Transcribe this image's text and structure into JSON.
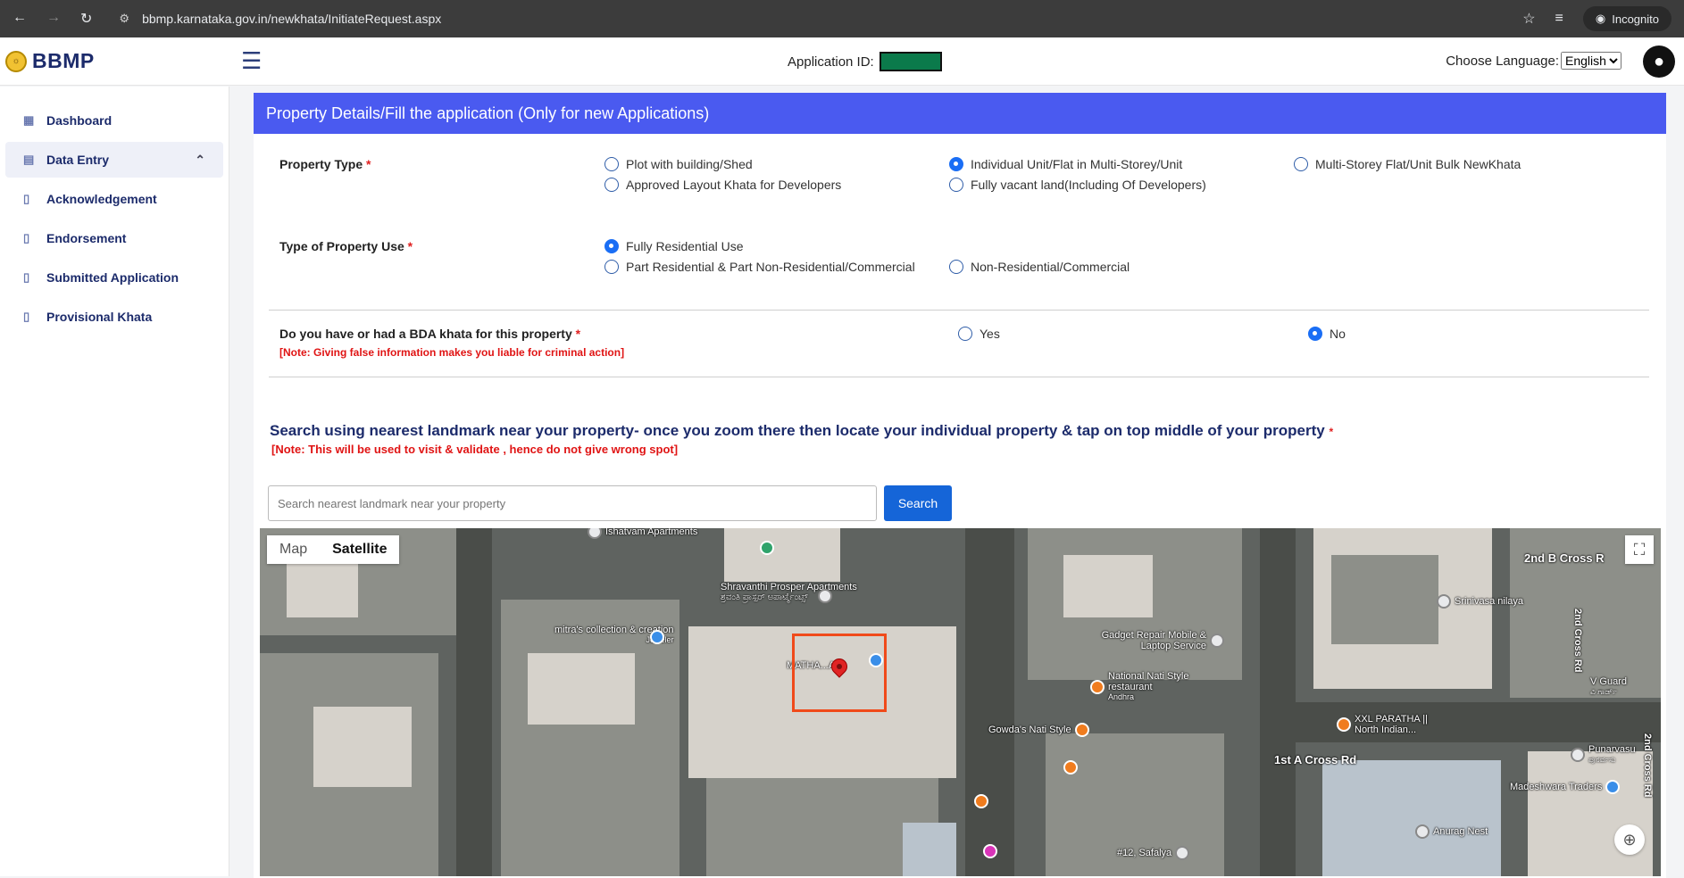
{
  "browser": {
    "url": "bbmp.karnataka.gov.in/newkhata/InitiateRequest.aspx",
    "incognito_label": "Incognito"
  },
  "header": {
    "brand": "BBMP",
    "application_id_label": "Application ID:",
    "language_label": "Choose Language:",
    "language_selected": "English"
  },
  "sidebar": {
    "items": [
      {
        "label": "Dashboard"
      },
      {
        "label": "Data Entry"
      },
      {
        "label": "Acknowledgement"
      },
      {
        "label": "Endorsement"
      },
      {
        "label": "Submitted Application"
      },
      {
        "label": "Provisional Khata"
      }
    ]
  },
  "form": {
    "title": "Property Details/Fill the application (Only for new Applications)",
    "property_type": {
      "label": "Property Type",
      "options": [
        {
          "label": "Plot with building/Shed",
          "selected": false
        },
        {
          "label": "Individual Unit/Flat in Multi-Storey/Unit",
          "selected": true
        },
        {
          "label": "Multi-Storey Flat/Unit Bulk NewKhata",
          "selected": false
        },
        {
          "label": "Approved Layout Khata for Developers",
          "selected": false
        },
        {
          "label": "Fully vacant land(Including Of Developers)",
          "selected": false
        }
      ]
    },
    "property_use": {
      "label": "Type of Property Use",
      "options": [
        {
          "label": "Fully Residential Use",
          "selected": true
        },
        {
          "label": "Part Residential & Part Non-Residential/Commercial",
          "selected": false
        },
        {
          "label": "Non-Residential/Commercial",
          "selected": false
        }
      ]
    },
    "bda_khata": {
      "label": "Do you have or had a BDA khata for this property",
      "note": "[Note: Giving false information makes you liable for criminal action]",
      "options": [
        {
          "label": "Yes",
          "selected": false
        },
        {
          "label": "No",
          "selected": true
        }
      ]
    },
    "landmark": {
      "title": "Search using nearest landmark near your property- once you zoom there then locate your individual property & tap on top middle of your property",
      "note": "[Note: This will be used to visit & validate , hence do not give wrong spot]",
      "placeholder": "Search nearest landmark near your property",
      "button": "Search"
    },
    "required_mark": "*"
  },
  "map": {
    "type_map": "Map",
    "type_satellite": "Satellite",
    "selected_type": "Satellite",
    "pois": [
      "Ishatvam Apartments",
      "Shravanthi Prosper Apartments",
      "ಶ್ರವಂತಿ ಪ್ರಾಸ್ಪರ್ ಅಪಾರ್ಟ್ಮೆಂಟ್ಸ್",
      "mitra's collection & creation",
      "Jeweler",
      "MATHA...AS",
      "Gadget Repair Mobile & Laptop Service",
      "National Nati Style restaurant",
      "Andhra",
      "Gowda's Nati Style",
      "XXL PARATHA || North Indian...",
      "Srinivasa nilaya",
      "V Guard",
      "ವಿ ಗಾರ್ಡ್",
      "Punarvasu",
      "ಪುನರ್ವಸು",
      "Madeshwara Traders",
      "Anurag Nest",
      "#12, Safalya"
    ],
    "streets": [
      "2nd B Cross R",
      "1st A Cross Rd",
      "2nd Cross Rd",
      "2nd Cross Rd"
    ]
  },
  "colors": {
    "form_header": "#4a5af0",
    "sidebar_text": "#1c2b6b",
    "note_red": "#e01414",
    "search_button": "#1565d8"
  }
}
